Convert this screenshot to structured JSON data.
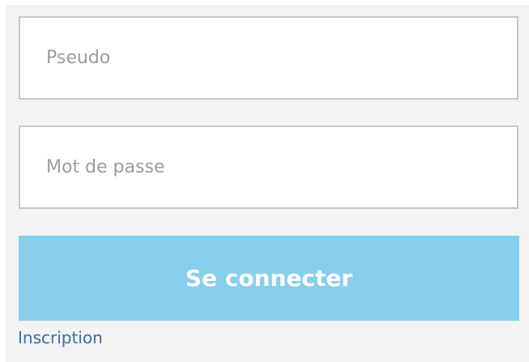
{
  "login_form": {
    "username": {
      "placeholder": "Pseudo",
      "value": ""
    },
    "password": {
      "placeholder": "Mot de passe",
      "value": ""
    },
    "submit_label": "Se connecter",
    "register_link": "Inscription"
  },
  "colors": {
    "panel_background": "#f3f3f3",
    "button_background": "#87ceeb",
    "button_text": "#ffffff",
    "link_text": "#3a6ea5",
    "field_border": "#c7c7c7",
    "placeholder_text": "#9c9c9c"
  }
}
